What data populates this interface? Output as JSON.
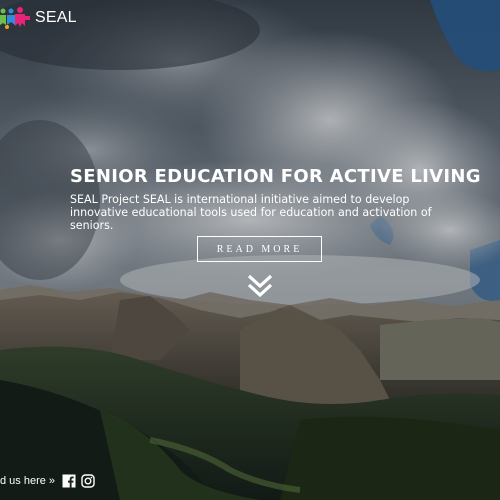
{
  "logo": {
    "text": "SEAL",
    "icon": "puzzle-people-logo",
    "colors": [
      "#6cc04a",
      "#2e8fd8",
      "#e8247a",
      "#f2a518"
    ]
  },
  "hero": {
    "headline": "SENIOR EDUCATION FOR ACTIVE LIVING",
    "description": "SEAL Project SEAL is international initiative aimed to develop innovative educational tools used for education and activation of seniors.",
    "cta_label": "READ MORE",
    "scroll_icon": "double-chevron-down-icon"
  },
  "footer": {
    "follow_label": "d us here »",
    "social": [
      {
        "name": "facebook-icon"
      },
      {
        "name": "instagram-icon"
      }
    ]
  }
}
